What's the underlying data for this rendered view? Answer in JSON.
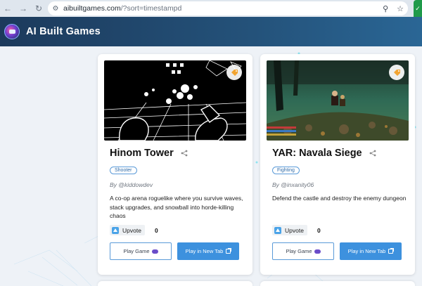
{
  "browser": {
    "url_host": "aibuiltgames.com",
    "url_path": "/?sort=timestampd"
  },
  "header": {
    "title": "AI Built Games"
  },
  "cards": [
    {
      "title": "Hinom Tower",
      "genre": "Shooter",
      "author": "By @kiddowdev",
      "description": "A co-op arena roguelike where you survive waves, stack upgrades, and snowball into horde-killing chaos",
      "upvote_label": "Upvote",
      "votes": "0",
      "play_label": "Play Game",
      "newtab_label": "Play in New Tab"
    },
    {
      "title": "YAR: Navala Siege",
      "genre": "Fighting",
      "author": "By @inxanity06",
      "description": "Defend the castle and destroy the enemy dungeon",
      "upvote_label": "Upvote",
      "votes": "0",
      "play_label": "Play Game",
      "newtab_label": "Play in New Tab"
    }
  ],
  "colors": {
    "header_start": "#1c3a5c",
    "header_end": "#2a6695",
    "accent": "#3d91de",
    "pill_border": "#5a9ad8"
  },
  "icons": [
    "back-arrow-icon",
    "forward-arrow-icon",
    "reload-icon",
    "site-settings-icon",
    "zoom-icon",
    "star-icon",
    "tag-icon",
    "share-icon",
    "upvote-icon",
    "gamepad-icon",
    "external-link-icon"
  ]
}
